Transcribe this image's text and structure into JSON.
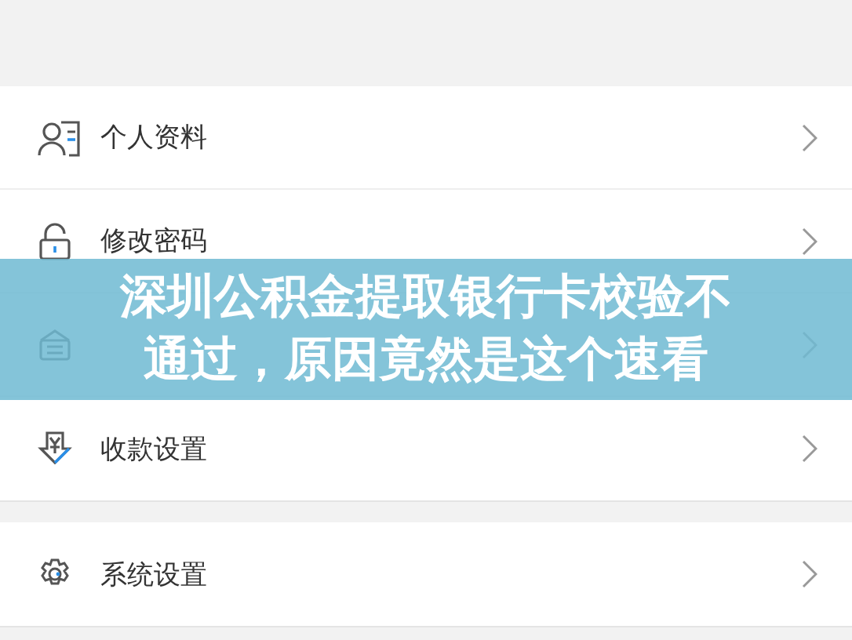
{
  "groups": [
    {
      "items": [
        {
          "kind": "profile",
          "label": "个人资料"
        },
        {
          "kind": "lock",
          "label": "修改密码"
        },
        {
          "kind": "card"
        },
        {
          "kind": "yuan",
          "label": "收款设置"
        }
      ]
    },
    {
      "items": [
        {
          "kind": "gear",
          "label": "系统设置"
        }
      ]
    }
  ],
  "banner": {
    "lines": [
      "深圳公积金提取银行卡校验不",
      "通过，原因竟然是这个速看"
    ]
  }
}
